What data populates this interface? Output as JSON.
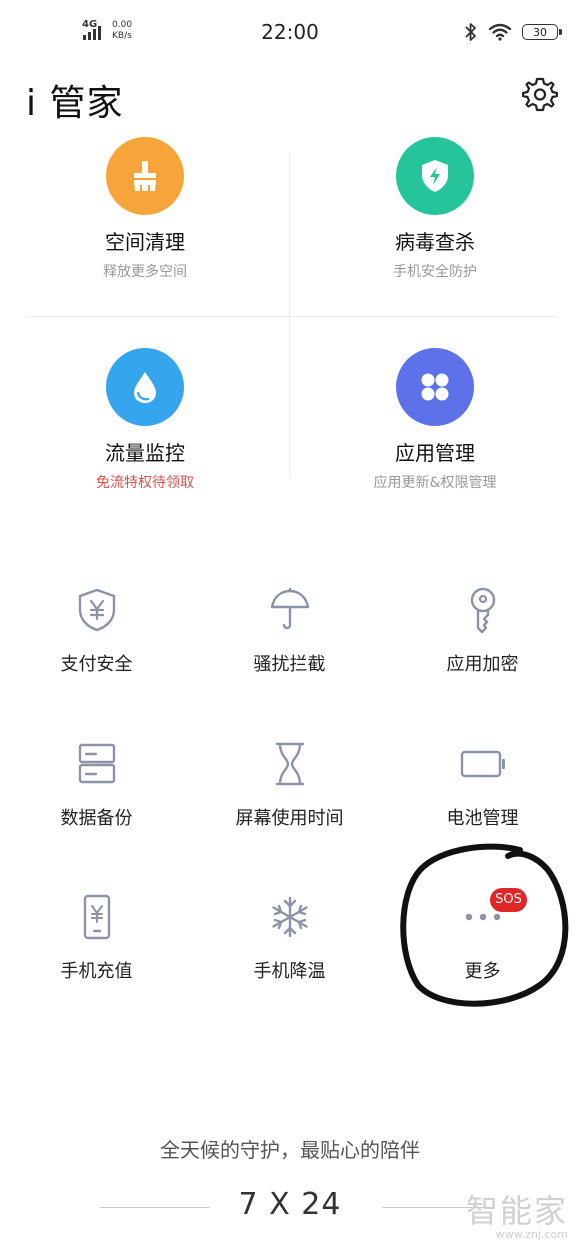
{
  "status_bar": {
    "network": "4G",
    "speed_value": "0.00",
    "speed_unit": "KB/s",
    "time": "22:00",
    "battery": "30"
  },
  "header": {
    "title": "i 管家"
  },
  "features": [
    {
      "title": "空间清理",
      "subtitle": "释放更多空间",
      "icon": "broom-icon",
      "color": "#f7a43b"
    },
    {
      "title": "病毒查杀",
      "subtitle": "手机安全防护",
      "icon": "shield-bolt-icon",
      "color": "#26c49a"
    },
    {
      "title": "流量监控",
      "subtitle": "免流特权待领取",
      "icon": "water-drop-icon",
      "color": "#35a6ee"
    },
    {
      "title": "应用管理",
      "subtitle": "应用更新&权限管理",
      "icon": "apps-grid-icon",
      "color": "#5d72e8"
    }
  ],
  "tools": [
    {
      "label": "支付安全",
      "icon": "yuan-shield-icon"
    },
    {
      "label": "骚扰拦截",
      "icon": "umbrella-icon"
    },
    {
      "label": "应用加密",
      "icon": "key-icon"
    },
    {
      "label": "数据备份",
      "icon": "storage-icon"
    },
    {
      "label": "屏幕使用时间",
      "icon": "hourglass-icon"
    },
    {
      "label": "电池管理",
      "icon": "battery-icon"
    },
    {
      "label": "手机充值",
      "icon": "phone-yuan-icon"
    },
    {
      "label": "手机降温",
      "icon": "snowflake-icon"
    },
    {
      "label": "更多",
      "icon": "more-dots-icon",
      "badge": "SOS"
    }
  ],
  "footer": {
    "slogan": "全天候的守护，最贴心的陪伴",
    "slogan2": "7 X 24"
  },
  "watermark": {
    "brand": "智能家",
    "url": "www.znj.com"
  },
  "colors": {
    "tool_icon": "#8c93a8",
    "badge": "#e02626"
  }
}
